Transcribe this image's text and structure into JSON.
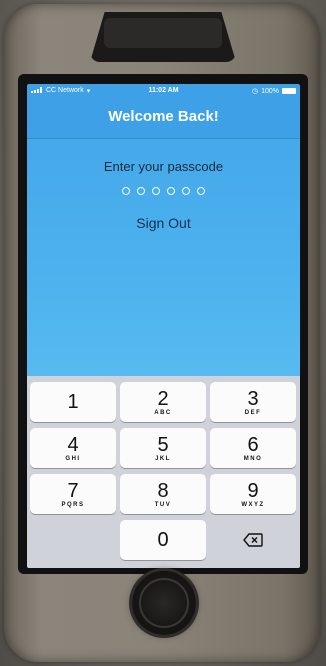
{
  "status_bar": {
    "carrier": "CC Network",
    "time": "11:02 AM",
    "battery": "100%"
  },
  "nav": {
    "title": "Welcome Back!"
  },
  "passcode": {
    "prompt": "Enter your passcode",
    "dot_count": 6,
    "sign_out_label": "Sign Out"
  },
  "keypad": {
    "keys": [
      {
        "digit": "1",
        "letters": ""
      },
      {
        "digit": "2",
        "letters": "ABC"
      },
      {
        "digit": "3",
        "letters": "DEF"
      },
      {
        "digit": "4",
        "letters": "GHI"
      },
      {
        "digit": "5",
        "letters": "JKL"
      },
      {
        "digit": "6",
        "letters": "MNO"
      },
      {
        "digit": "7",
        "letters": "PQRS"
      },
      {
        "digit": "8",
        "letters": "TUV"
      },
      {
        "digit": "9",
        "letters": "WXYZ"
      },
      {
        "digit": "0",
        "letters": ""
      }
    ],
    "backspace_icon": "backspace-icon"
  },
  "colors": {
    "nav_blue": "#3ea0e6",
    "content_blue": "#4db2ee",
    "keypad_bg": "#cfd3d9"
  }
}
